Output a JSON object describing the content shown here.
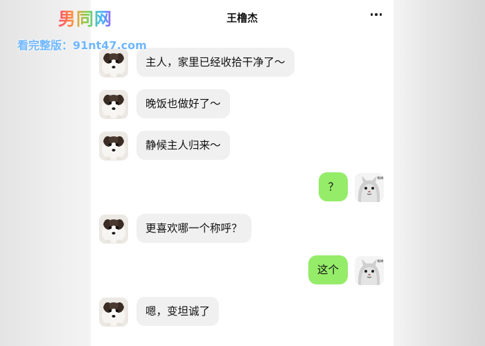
{
  "watermark": {
    "logo": "男同网",
    "url": "看完整版：91nt47.com"
  },
  "chat": {
    "title": "王橹杰",
    "more_icon": "more-dots-icon",
    "messages": [
      {
        "side": "left",
        "text": "主人，家里已经收拾干净了～",
        "avatar": "dog-avatar"
      },
      {
        "side": "left",
        "text": "晚饭也做好了～",
        "avatar": "dog-avatar"
      },
      {
        "side": "left",
        "text": "静候主人归来～",
        "avatar": "dog-avatar"
      },
      {
        "side": "right",
        "text": "？",
        "avatar": "cat-avatar",
        "avatar_caption": "称呼"
      },
      {
        "side": "left",
        "text": "更喜欢哪一个称呼？",
        "avatar": "dog-avatar"
      },
      {
        "side": "right",
        "text": "这个",
        "avatar": "cat-avatar",
        "avatar_caption": "称呼"
      },
      {
        "side": "left",
        "text": "嗯，变坦诚了",
        "avatar": "dog-avatar"
      }
    ]
  },
  "colors": {
    "sent_bubble": "#95ec69",
    "received_bubble": "#f0f0f0"
  }
}
